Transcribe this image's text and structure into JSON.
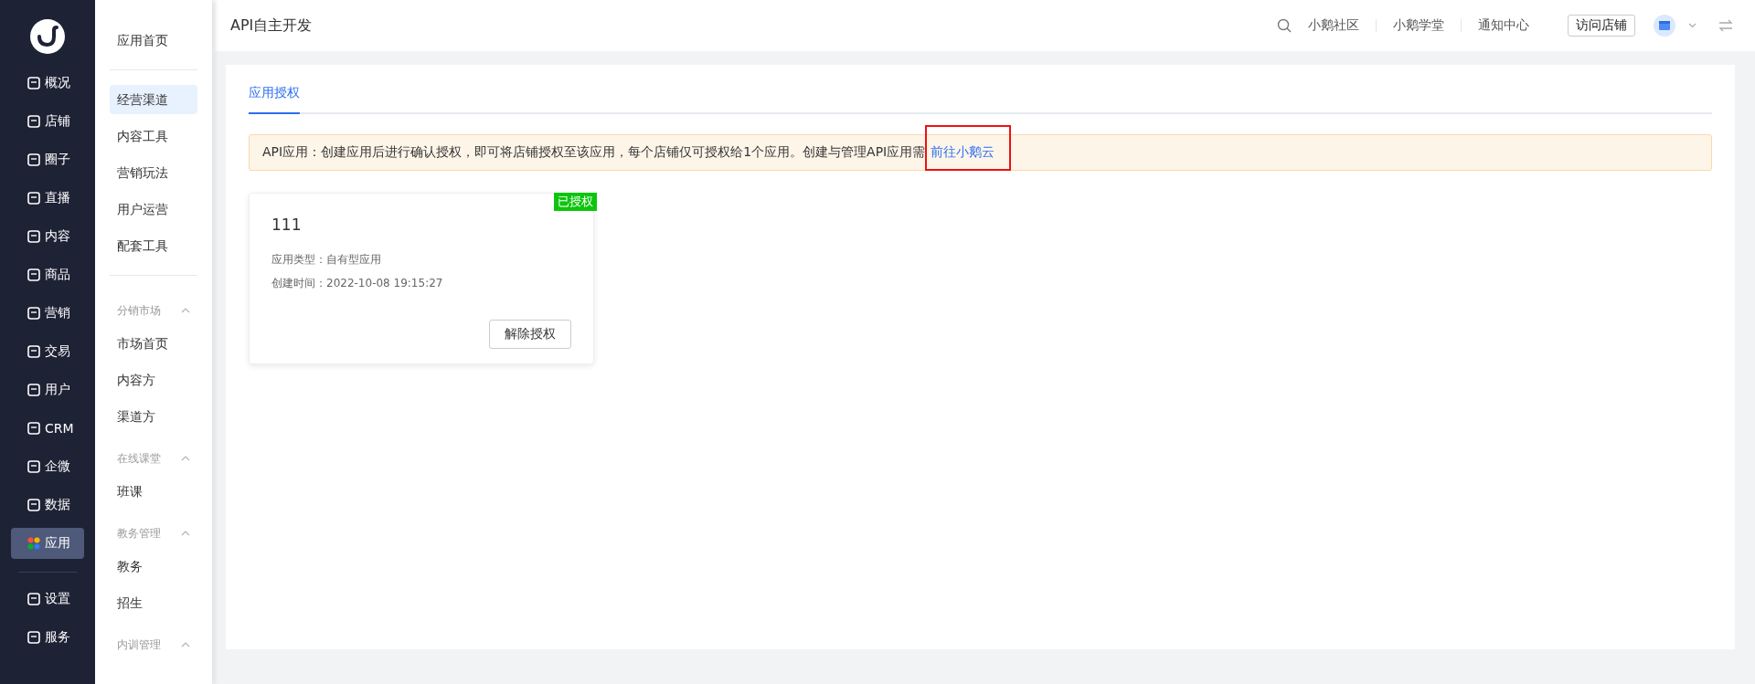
{
  "main_nav": {
    "items": [
      {
        "label": "概况",
        "selected": false
      },
      {
        "label": "店铺",
        "selected": false
      },
      {
        "label": "圈子",
        "selected": false
      },
      {
        "label": "直播",
        "selected": false
      },
      {
        "label": "内容",
        "selected": false
      },
      {
        "label": "商品",
        "selected": false
      },
      {
        "label": "营销",
        "selected": false
      },
      {
        "label": "交易",
        "selected": false
      },
      {
        "label": "用户",
        "selected": false
      },
      {
        "label": "CRM",
        "selected": false
      },
      {
        "label": "企微",
        "selected": false
      },
      {
        "label": "数据",
        "selected": false
      },
      {
        "label": "应用",
        "selected": true
      }
    ],
    "bottom_items": [
      {
        "label": "设置",
        "selected": false
      },
      {
        "label": "服务",
        "selected": false
      }
    ]
  },
  "sub_nav": {
    "home": {
      "label": "应用首页",
      "selected": false
    },
    "items": [
      {
        "label": "经营渠道",
        "selected": true
      },
      {
        "label": "内容工具",
        "selected": false
      },
      {
        "label": "营销玩法",
        "selected": false
      },
      {
        "label": "用户运营",
        "selected": false
      },
      {
        "label": "配套工具",
        "selected": false
      }
    ],
    "groups": [
      {
        "title": "分销市场",
        "expanded": true,
        "items": [
          {
            "label": "市场首页",
            "selected": false
          },
          {
            "label": "内容方",
            "selected": false
          },
          {
            "label": "渠道方",
            "selected": false
          }
        ]
      },
      {
        "title": "在线课堂",
        "expanded": true,
        "items": [
          {
            "label": "班课",
            "selected": false
          }
        ]
      },
      {
        "title": "教务管理",
        "expanded": true,
        "items": [
          {
            "label": "教务",
            "selected": false
          },
          {
            "label": "招生",
            "selected": false
          }
        ]
      },
      {
        "title": "内训管理",
        "expanded": true
      }
    ]
  },
  "header": {
    "title": "API自主开发",
    "links": [
      "小鹅社区",
      "小鹅学堂",
      "通知中心"
    ],
    "visit_button": "访问店铺"
  },
  "tabs": [
    {
      "label": "应用授权",
      "selected": true
    }
  ],
  "notice": {
    "text": "API应用：创建应用后进行确认授权，即可将店铺授权至该应用，每个店铺仅可授权给1个应用。创建与管理API应用需",
    "link": "前往小鹅云"
  },
  "apps": [
    {
      "name": "111",
      "badge": "已授权",
      "fields": [
        {
          "label": "应用类型：",
          "value": "自有型应用"
        },
        {
          "label": "创建时间：",
          "value": "2022-10-08 19:15:27"
        }
      ],
      "button": "解除授权"
    }
  ]
}
